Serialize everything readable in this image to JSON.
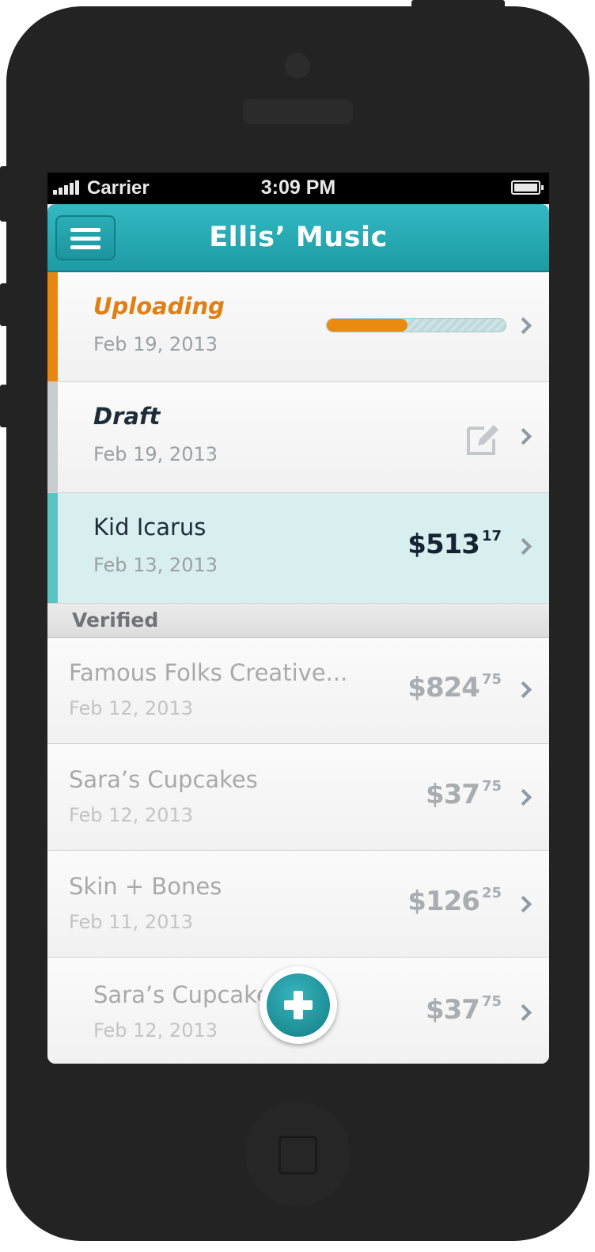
{
  "status_bar": {
    "carrier": "Carrier",
    "time": "3:09 PM"
  },
  "nav": {
    "title": "Ellis’ Music"
  },
  "pending_items": [
    {
      "title": "Uploading",
      "date": "Feb 19, 2013",
      "status": "uploading",
      "progress": 0.45
    },
    {
      "title": "Draft",
      "date": "Feb 19, 2013",
      "status": "draft"
    },
    {
      "title": "Kid Icarus",
      "date": "Feb 13, 2013",
      "status": "selected",
      "price_dollars": "$513",
      "price_cents": "17"
    }
  ],
  "section": {
    "label": "Verified"
  },
  "verified_items": [
    {
      "title": "Famous Folks Creative...",
      "date": "Feb 12, 2013",
      "price_dollars": "$824",
      "price_cents": "75"
    },
    {
      "title": "Sara’s Cupcakes",
      "date": "Feb 12, 2013",
      "price_dollars": "$37",
      "price_cents": "75"
    },
    {
      "title": "Skin + Bones",
      "date": "Feb 11, 2013",
      "price_dollars": "$126",
      "price_cents": "25"
    },
    {
      "title": "Sara’s Cupcakes",
      "date": "Feb 12, 2013",
      "price_dollars": "$37",
      "price_cents": "75"
    }
  ],
  "colors": {
    "accent_teal": "#2aaeb7",
    "uploading_orange": "#e8870f",
    "draft_gray": "#c7cccf",
    "selected_bg": "#d9efef"
  }
}
